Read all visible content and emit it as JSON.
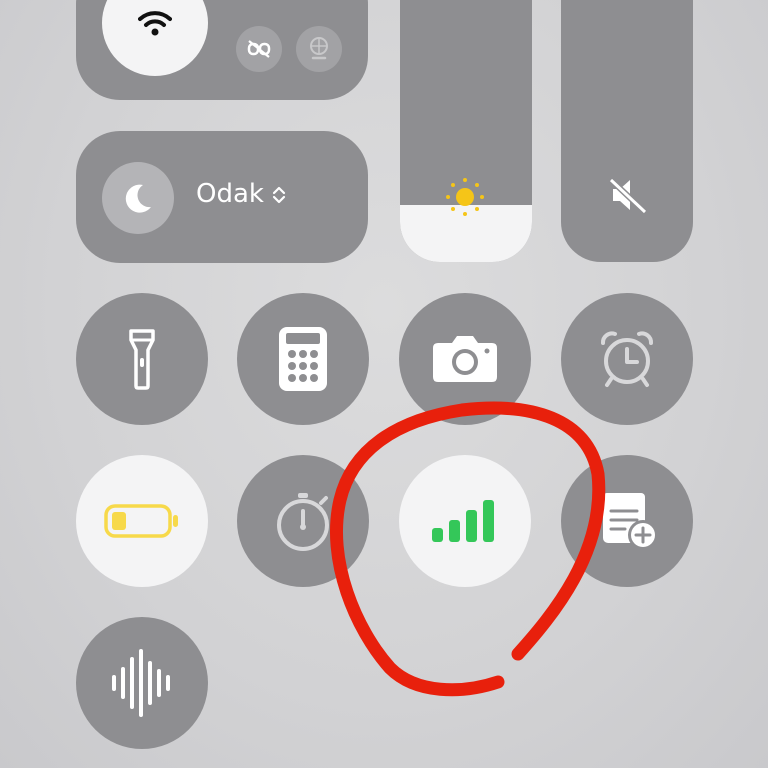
{
  "focus": {
    "label": "Odak"
  },
  "brightness": {
    "level": 0.19
  },
  "colors": {
    "tile": "#8e8e91",
    "active_tile": "#f4f4f5",
    "cellular_green": "#34c759",
    "battery_yellow": "#f7d94a",
    "sun_yellow": "#f5c518",
    "annotation_red": "#e8200c"
  },
  "icons": {
    "wifi": "wifi-icon",
    "cellular_data": "cellular-data-icon",
    "airdrop": "airdrop-icon",
    "hotspot": "hotspot-icon",
    "vpn": "vpn-icon",
    "focus": "moon-icon",
    "brightness": "sun-icon",
    "volume": "speaker-muted-icon",
    "flashlight": "flashlight-icon",
    "calculator": "calculator-icon",
    "camera": "camera-icon",
    "alarm": "alarm-clock-icon",
    "low_power": "battery-icon",
    "stopwatch": "stopwatch-icon",
    "cellular_signal": "signal-bars-icon",
    "quick_note": "quick-note-icon",
    "sound_recognition": "waveform-icon"
  }
}
